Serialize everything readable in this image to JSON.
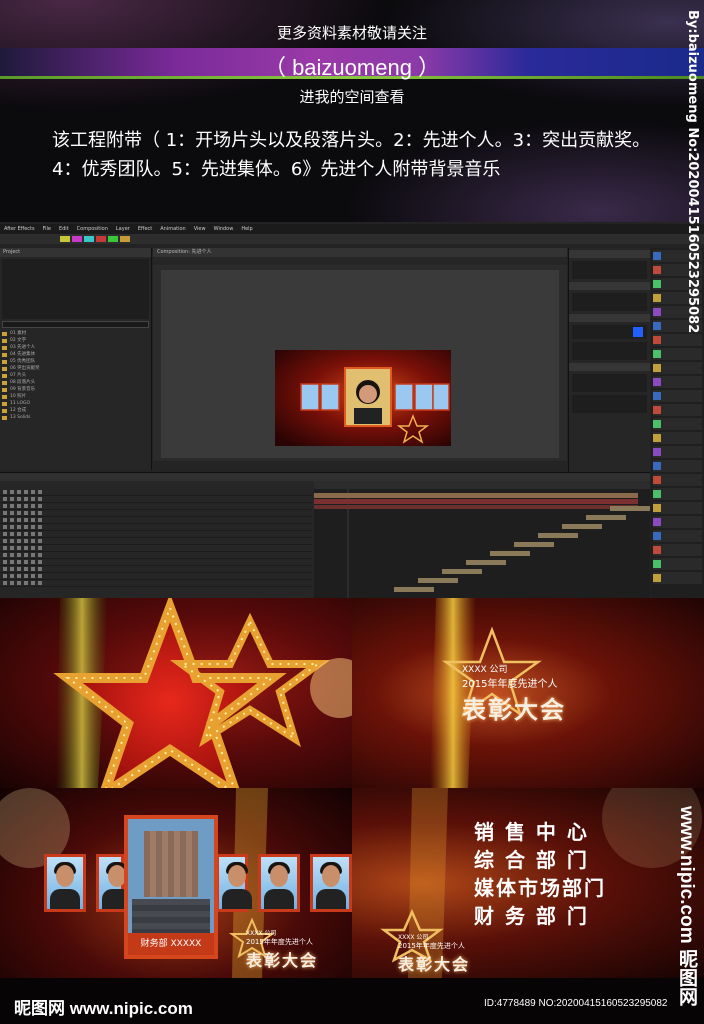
{
  "banner": {
    "heading": "更多资料素材敬请关注",
    "handle": "（ baizuomeng ）",
    "subheading": "进我的空间查看",
    "description": "该工程附带（ 1：开场片头以及段落片头。2：先进个人。3：突出贡献奖。4：优秀团队。5：先进集体。6》先进个人附带背景音乐",
    "vertical_watermark": "By:baizuomeng No:20200415160523295082"
  },
  "ae": {
    "menu": [
      "After Effects",
      "File",
      "Edit",
      "Composition",
      "Layer",
      "Effect",
      "Animation",
      "View",
      "Window",
      "Help"
    ],
    "project_tab": "Project",
    "comp_tab": "Composition: 先进个人",
    "project_items": [
      "01 素材",
      "02 文字",
      "03 先进个人",
      "04 先进集体",
      "05 优秀团队",
      "06 突出贡献奖",
      "07 片头",
      "08 段落片头",
      "09 背景音乐",
      "10 照片",
      "11 LOGO",
      "12 合成",
      "13 Solids"
    ],
    "layer_rows": 14
  },
  "frames": {
    "company": "XXXX 公司",
    "year_title": "2015年年度先进个人",
    "award": "表彰大会",
    "photo_caption": "财务部   XXXXX",
    "departments": [
      "销 售 中 心",
      "综 合 部 门",
      "媒体市场部门",
      "财 务 部 门"
    ]
  },
  "footer": {
    "logo": "昵图网 www.nipic.com",
    "id_text": "ID:4778489 NO:20200415160523295082",
    "side_url": "www.nipic.com  昵图网"
  },
  "colors": {
    "accent_red": "#c83a1a",
    "band_purple": "#9a3aa8",
    "band_green": "#8ac840",
    "ae_bg": "#232323"
  }
}
